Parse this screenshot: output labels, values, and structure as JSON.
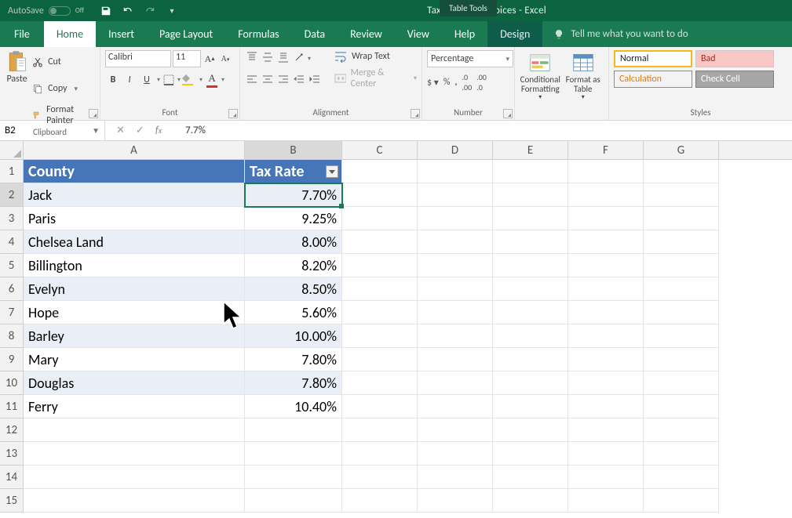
{
  "title": "Tax rates for invoices  -  Excel",
  "tabletools_label": "Table Tools",
  "autosave": {
    "label": "AutoSave",
    "state": "Off"
  },
  "tabs": {
    "file": "File",
    "home": "Home",
    "insert": "Insert",
    "pagelayout": "Page Layout",
    "formulas": "Formulas",
    "data": "Data",
    "review": "Review",
    "view": "View",
    "help": "Help",
    "design": "Design"
  },
  "tellme": "Tell me what you want to do",
  "clipboard": {
    "paste": "Paste",
    "cut": "Cut",
    "copy": "Copy",
    "fmtpainter": "Format Painter",
    "label": "Clipboard"
  },
  "font": {
    "name": "Calibri",
    "size": "11",
    "label": "Font",
    "bold": "B",
    "italic": "I",
    "underline": "U"
  },
  "alignment": {
    "wrap": "Wrap Text",
    "merge": "Merge & Center",
    "label": "Alignment"
  },
  "number": {
    "format": "Percentage",
    "label": "Number"
  },
  "cond": {
    "cf": "Conditional Formatting",
    "fat": "Format as Table"
  },
  "styles": {
    "normal": "Normal",
    "bad": "Bad",
    "calc": "Calculation",
    "check": "Check Cell",
    "label": "Styles"
  },
  "namebox": "B2",
  "formula": "7.7%",
  "columns": [
    "A",
    "B",
    "C",
    "D",
    "E",
    "F",
    "G"
  ],
  "headers": {
    "county": "County",
    "rate": "Tax Rate"
  },
  "data_rows": [
    {
      "county": "Jack",
      "rate": "7.70%"
    },
    {
      "county": "Paris",
      "rate": "9.25%"
    },
    {
      "county": "Chelsea Land",
      "rate": "8.00%"
    },
    {
      "county": "Billington",
      "rate": "8.20%"
    },
    {
      "county": "Evelyn",
      "rate": "8.50%"
    },
    {
      "county": "Hope",
      "rate": "5.60%"
    },
    {
      "county": "Barley",
      "rate": "10.00%"
    },
    {
      "county": "Mary",
      "rate": "7.80%"
    },
    {
      "county": "Douglas",
      "rate": "7.80%"
    },
    {
      "county": "Ferry",
      "rate": "10.40%"
    }
  ],
  "empty_tail_rows": 4
}
